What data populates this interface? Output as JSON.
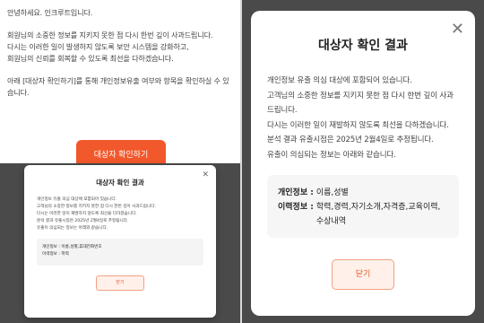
{
  "notice": {
    "lines": [
      "안녕하세요. 인크루트입니다.",
      "회원님의 소중한 정보를 지키지 못한 점 다시 한번 깊이 사과드립니다.",
      "다시는 이러한 일이 발생하지 않도록 보안 시스템을 강화하고,",
      "회원님의 신뢰를 회복할 수 있도록 최선을 다하겠습니다.",
      "아래 [대상자 확인하기]를 통해 개인정보유출 여부와 항목을 확인하실 수 있습니다."
    ],
    "cta_label": "대상자 확인하기"
  },
  "modal_small": {
    "title": "대상자 확인 결과",
    "body": [
      "개인정보 유출 의심 대상에 포함되어 있습니다.",
      "고객님의 소중한 정보를 지키지 못한 점 다시 한번 깊이 사과드립니다.",
      "다시는 이러한 일이 재발하지 않도록 최선을 다하겠습니다.",
      "분석 결과 유출시점은 2025년 2월4일로 추정됩니다.",
      "유출이 의심되는 정보는 아래와 같습니다."
    ],
    "personal_label": "개인정보 :",
    "personal_value": "이름,성별,휴대전화번호",
    "career_label": "이력정보 :",
    "career_value": "학력",
    "close_label": "닫기"
  },
  "modal_large": {
    "title": "대상자 확인 결과",
    "body": [
      "개인정보 유출 의심 대상에 포함되어 있습니다.",
      "고객님의 소중한 정보를 지키지 못한 점 다시 한번 깊이 사과드립니다.",
      "다시는 이러한 일이 재발하지 않도록 최선을 다하겠습니다.",
      "분석 결과 유출시점은 2025년 2월4일로 추정됩니다.",
      "유출이 의심되는 정보는 아래와 같습니다."
    ],
    "personal_label": "개인정보 :",
    "personal_value": "이름,성별",
    "career_label": "이력정보 :",
    "career_value": "학력,경력,자기소개,자격증,교육이력, 수상내역",
    "close_label": "닫기"
  },
  "colors": {
    "accent": "#f1582b",
    "button_bg": "#fff1ea",
    "button_border": "#f2a183",
    "overlay": "#4a4a4a"
  },
  "icons": {
    "close": "close-icon"
  }
}
